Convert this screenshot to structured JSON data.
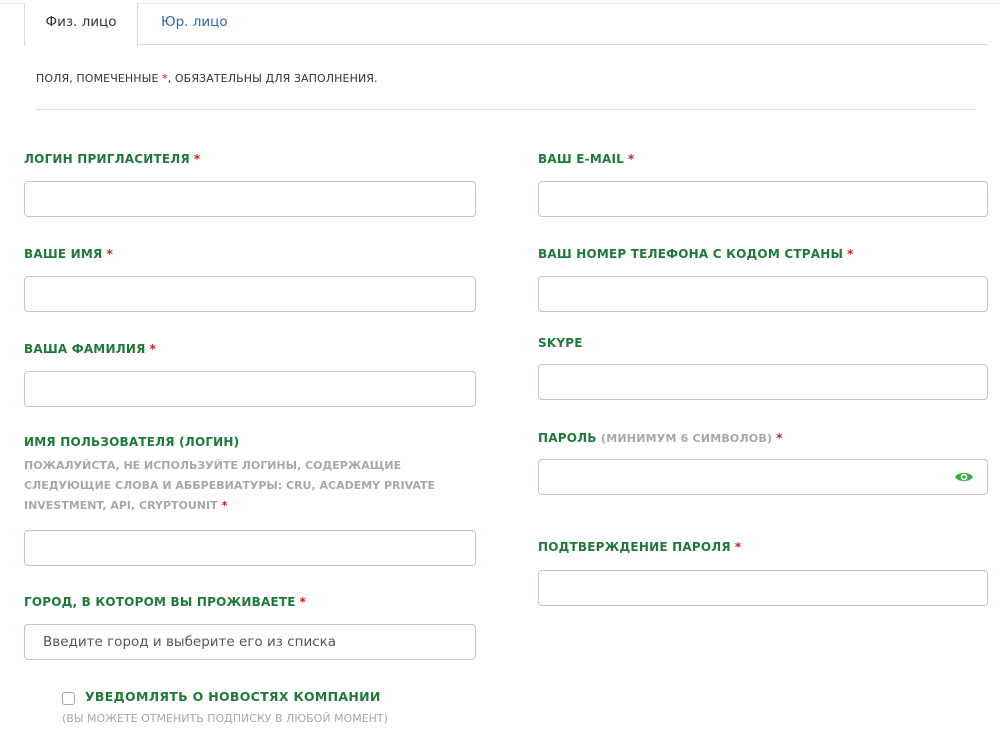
{
  "tabs": [
    {
      "label": "Физ. лицо",
      "active": true
    },
    {
      "label": "Юр. лицо",
      "active": false
    }
  ],
  "notice": {
    "before": "ПОЛЯ, ПОМЕЧЕННЫЕ ",
    "star": "*",
    "after": ", ОБЯЗАТЕЛЬНЫ ДЛЯ ЗАПОЛНЕНИЯ."
  },
  "required_mark": "*",
  "fields": {
    "inviter_login": {
      "label": "ЛОГИН ПРИГЛАСИТЕЛЯ",
      "value": ""
    },
    "first_name": {
      "label": "ВАШЕ ИМЯ",
      "value": ""
    },
    "last_name": {
      "label": "ВАША ФАМИЛИЯ",
      "value": ""
    },
    "username": {
      "label": "ИМЯ ПОЛЬЗОВАТЕЛЯ (ЛОГИН)",
      "help": "ПОЖАЛУЙСТА, НЕ ИСПОЛЬЗУЙТЕ ЛОГИНЫ, СОДЕРЖАЩИЕ СЛЕДУЮЩИЕ СЛОВА И АББРЕВИАТУРЫ: CRU, ACADEMY PRIVATE INVESTMENT, API, CRYPTOUNIT",
      "value": ""
    },
    "city": {
      "label": "ГОРОД, В КОТОРОМ ВЫ ПРОЖИВАЕТЕ",
      "placeholder": "Введите город и выберите его из списка",
      "value": ""
    },
    "email": {
      "label": "ВАШ E-MAIL",
      "value": ""
    },
    "phone": {
      "label": "ВАШ НОМЕР ТЕЛЕФОНА С КОДОМ СТРАНЫ",
      "value": ""
    },
    "skype": {
      "label": "SKYPE",
      "value": ""
    },
    "password": {
      "label": "ПАРОЛЬ",
      "hint": "(МИНИМУМ 6 СИМВОЛОВ)",
      "value": ""
    },
    "password_confirm": {
      "label": "ПОДТВЕРЖДЕНИЕ ПАРОЛЯ",
      "value": ""
    }
  },
  "newsletter": {
    "checked": false,
    "label": "УВЕДОМЛЯТЬ О НОВОСТЯХ КОМПАНИИ",
    "sublabel": "(ВЫ МОЖЕТЕ ОТМЕНИТЬ ПОДПИСКУ В ЛЮБОЙ МОМЕНТ)"
  },
  "colors": {
    "label_green": "#1f7a3a",
    "required_red": "#d01a1a",
    "link_blue": "#2a66b4",
    "eye_green": "#3cb043"
  },
  "icons": {
    "password_toggle": "eye-icon"
  }
}
